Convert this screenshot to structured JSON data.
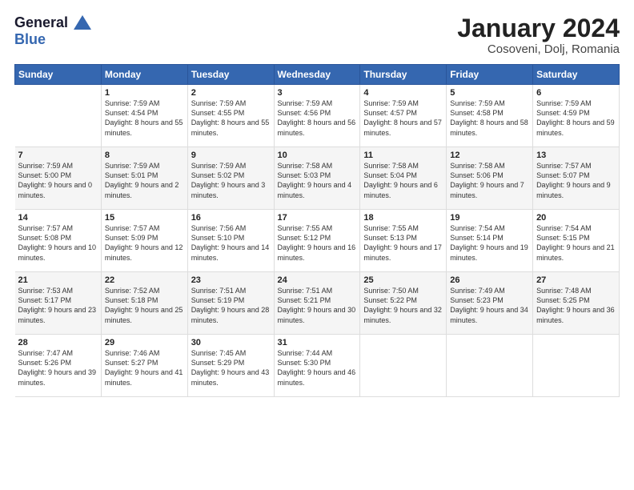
{
  "header": {
    "logo_line1": "General",
    "logo_line2": "Blue",
    "month": "January 2024",
    "location": "Cosoveni, Dolj, Romania"
  },
  "weekdays": [
    "Sunday",
    "Monday",
    "Tuesday",
    "Wednesday",
    "Thursday",
    "Friday",
    "Saturday"
  ],
  "weeks": [
    [
      {
        "day": "",
        "sunrise": "",
        "sunset": "",
        "daylight": ""
      },
      {
        "day": "1",
        "sunrise": "Sunrise: 7:59 AM",
        "sunset": "Sunset: 4:54 PM",
        "daylight": "Daylight: 8 hours and 55 minutes."
      },
      {
        "day": "2",
        "sunrise": "Sunrise: 7:59 AM",
        "sunset": "Sunset: 4:55 PM",
        "daylight": "Daylight: 8 hours and 55 minutes."
      },
      {
        "day": "3",
        "sunrise": "Sunrise: 7:59 AM",
        "sunset": "Sunset: 4:56 PM",
        "daylight": "Daylight: 8 hours and 56 minutes."
      },
      {
        "day": "4",
        "sunrise": "Sunrise: 7:59 AM",
        "sunset": "Sunset: 4:57 PM",
        "daylight": "Daylight: 8 hours and 57 minutes."
      },
      {
        "day": "5",
        "sunrise": "Sunrise: 7:59 AM",
        "sunset": "Sunset: 4:58 PM",
        "daylight": "Daylight: 8 hours and 58 minutes."
      },
      {
        "day": "6",
        "sunrise": "Sunrise: 7:59 AM",
        "sunset": "Sunset: 4:59 PM",
        "daylight": "Daylight: 8 hours and 59 minutes."
      }
    ],
    [
      {
        "day": "7",
        "sunrise": "Sunrise: 7:59 AM",
        "sunset": "Sunset: 5:00 PM",
        "daylight": "Daylight: 9 hours and 0 minutes."
      },
      {
        "day": "8",
        "sunrise": "Sunrise: 7:59 AM",
        "sunset": "Sunset: 5:01 PM",
        "daylight": "Daylight: 9 hours and 2 minutes."
      },
      {
        "day": "9",
        "sunrise": "Sunrise: 7:59 AM",
        "sunset": "Sunset: 5:02 PM",
        "daylight": "Daylight: 9 hours and 3 minutes."
      },
      {
        "day": "10",
        "sunrise": "Sunrise: 7:58 AM",
        "sunset": "Sunset: 5:03 PM",
        "daylight": "Daylight: 9 hours and 4 minutes."
      },
      {
        "day": "11",
        "sunrise": "Sunrise: 7:58 AM",
        "sunset": "Sunset: 5:04 PM",
        "daylight": "Daylight: 9 hours and 6 minutes."
      },
      {
        "day": "12",
        "sunrise": "Sunrise: 7:58 AM",
        "sunset": "Sunset: 5:06 PM",
        "daylight": "Daylight: 9 hours and 7 minutes."
      },
      {
        "day": "13",
        "sunrise": "Sunrise: 7:57 AM",
        "sunset": "Sunset: 5:07 PM",
        "daylight": "Daylight: 9 hours and 9 minutes."
      }
    ],
    [
      {
        "day": "14",
        "sunrise": "Sunrise: 7:57 AM",
        "sunset": "Sunset: 5:08 PM",
        "daylight": "Daylight: 9 hours and 10 minutes."
      },
      {
        "day": "15",
        "sunrise": "Sunrise: 7:57 AM",
        "sunset": "Sunset: 5:09 PM",
        "daylight": "Daylight: 9 hours and 12 minutes."
      },
      {
        "day": "16",
        "sunrise": "Sunrise: 7:56 AM",
        "sunset": "Sunset: 5:10 PM",
        "daylight": "Daylight: 9 hours and 14 minutes."
      },
      {
        "day": "17",
        "sunrise": "Sunrise: 7:55 AM",
        "sunset": "Sunset: 5:12 PM",
        "daylight": "Daylight: 9 hours and 16 minutes."
      },
      {
        "day": "18",
        "sunrise": "Sunrise: 7:55 AM",
        "sunset": "Sunset: 5:13 PM",
        "daylight": "Daylight: 9 hours and 17 minutes."
      },
      {
        "day": "19",
        "sunrise": "Sunrise: 7:54 AM",
        "sunset": "Sunset: 5:14 PM",
        "daylight": "Daylight: 9 hours and 19 minutes."
      },
      {
        "day": "20",
        "sunrise": "Sunrise: 7:54 AM",
        "sunset": "Sunset: 5:15 PM",
        "daylight": "Daylight: 9 hours and 21 minutes."
      }
    ],
    [
      {
        "day": "21",
        "sunrise": "Sunrise: 7:53 AM",
        "sunset": "Sunset: 5:17 PM",
        "daylight": "Daylight: 9 hours and 23 minutes."
      },
      {
        "day": "22",
        "sunrise": "Sunrise: 7:52 AM",
        "sunset": "Sunset: 5:18 PM",
        "daylight": "Daylight: 9 hours and 25 minutes."
      },
      {
        "day": "23",
        "sunrise": "Sunrise: 7:51 AM",
        "sunset": "Sunset: 5:19 PM",
        "daylight": "Daylight: 9 hours and 28 minutes."
      },
      {
        "day": "24",
        "sunrise": "Sunrise: 7:51 AM",
        "sunset": "Sunset: 5:21 PM",
        "daylight": "Daylight: 9 hours and 30 minutes."
      },
      {
        "day": "25",
        "sunrise": "Sunrise: 7:50 AM",
        "sunset": "Sunset: 5:22 PM",
        "daylight": "Daylight: 9 hours and 32 minutes."
      },
      {
        "day": "26",
        "sunrise": "Sunrise: 7:49 AM",
        "sunset": "Sunset: 5:23 PM",
        "daylight": "Daylight: 9 hours and 34 minutes."
      },
      {
        "day": "27",
        "sunrise": "Sunrise: 7:48 AM",
        "sunset": "Sunset: 5:25 PM",
        "daylight": "Daylight: 9 hours and 36 minutes."
      }
    ],
    [
      {
        "day": "28",
        "sunrise": "Sunrise: 7:47 AM",
        "sunset": "Sunset: 5:26 PM",
        "daylight": "Daylight: 9 hours and 39 minutes."
      },
      {
        "day": "29",
        "sunrise": "Sunrise: 7:46 AM",
        "sunset": "Sunset: 5:27 PM",
        "daylight": "Daylight: 9 hours and 41 minutes."
      },
      {
        "day": "30",
        "sunrise": "Sunrise: 7:45 AM",
        "sunset": "Sunset: 5:29 PM",
        "daylight": "Daylight: 9 hours and 43 minutes."
      },
      {
        "day": "31",
        "sunrise": "Sunrise: 7:44 AM",
        "sunset": "Sunset: 5:30 PM",
        "daylight": "Daylight: 9 hours and 46 minutes."
      },
      {
        "day": "",
        "sunrise": "",
        "sunset": "",
        "daylight": ""
      },
      {
        "day": "",
        "sunrise": "",
        "sunset": "",
        "daylight": ""
      },
      {
        "day": "",
        "sunrise": "",
        "sunset": "",
        "daylight": ""
      }
    ]
  ]
}
